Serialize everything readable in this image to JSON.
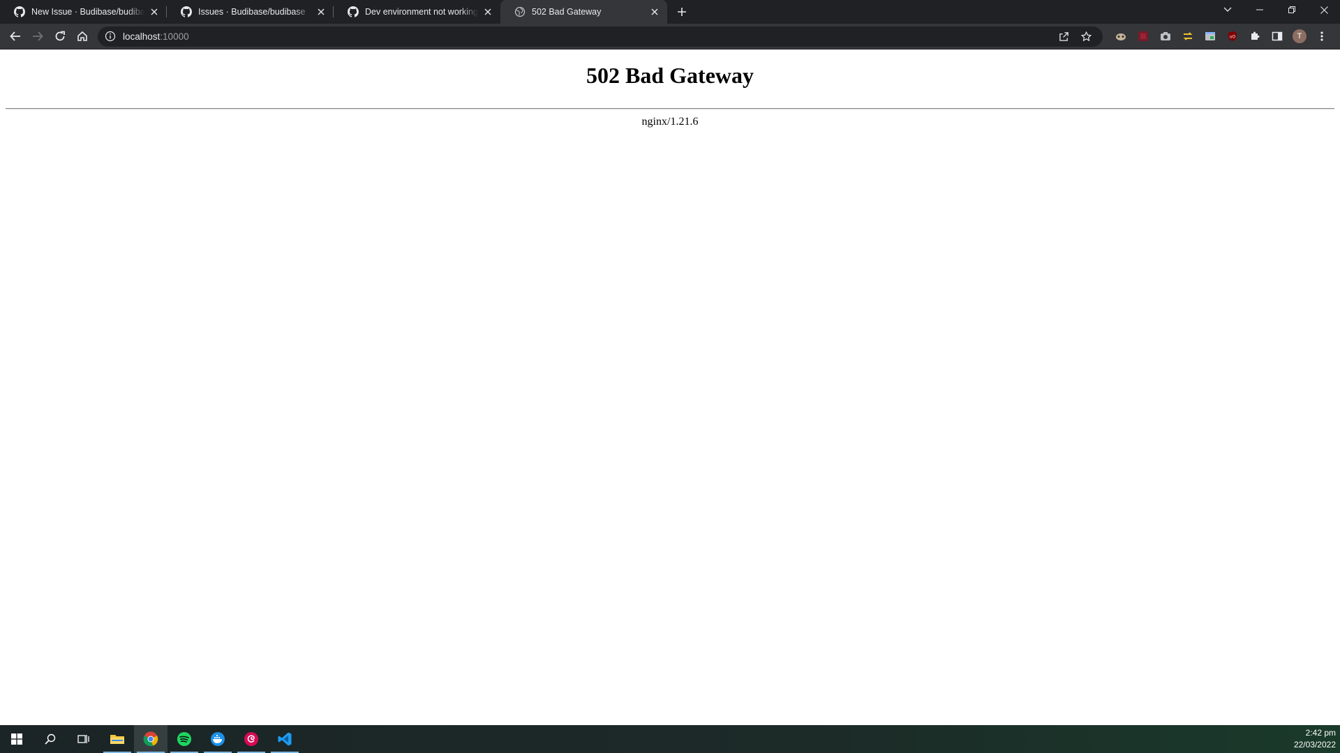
{
  "browser": {
    "tabs": [
      {
        "title": "New Issue · Budibase/budibase",
        "icon": "github-icon",
        "active": false
      },
      {
        "title": "Issues · Budibase/budibase",
        "icon": "github-icon",
        "active": false
      },
      {
        "title": "Dev environment not working as expected",
        "icon": "github-icon",
        "active": false
      },
      {
        "title": "502 Bad Gateway",
        "icon": "globe-icon",
        "active": true
      }
    ],
    "address": {
      "host": "localhost",
      "port": ":10000"
    },
    "profile_initial": "T"
  },
  "page": {
    "heading": "502 Bad Gateway",
    "server": "nginx/1.21.6"
  },
  "taskbar": {
    "apps": [
      "start",
      "search",
      "task-view",
      "file-explorer",
      "chrome",
      "spotify",
      "docker",
      "debian",
      "vscode"
    ],
    "time": "2:42 pm",
    "date": "22/03/2022"
  },
  "colors": {
    "titlebar": "#202124",
    "toolbar": "#35363a",
    "omnibox": "#202124"
  }
}
